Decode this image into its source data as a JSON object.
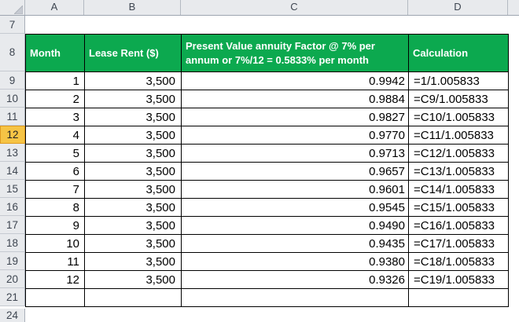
{
  "grid": {
    "columns": [
      "A",
      "B",
      "C",
      "D"
    ],
    "row_labels": [
      "7",
      "8",
      "9",
      "10",
      "11",
      "12",
      "13",
      "14",
      "15",
      "16",
      "17",
      "18",
      "19",
      "20",
      "21",
      "24"
    ],
    "selected_row_label": "12"
  },
  "table": {
    "headers": {
      "month": "Month",
      "lease_rent": "Lease Rent ($)",
      "pv_factor": "Present Value annuity Factor @ 7% per\nannum or 7%/12 = 0.5833% per month",
      "calculation": "Calculation"
    },
    "rows": [
      {
        "month": "1",
        "lease_rent": "3,500",
        "pv_factor": "0.9942",
        "calculation": "=1/1.005833"
      },
      {
        "month": "2",
        "lease_rent": "3,500",
        "pv_factor": "0.9884",
        "calculation": "=C9/1.005833"
      },
      {
        "month": "3",
        "lease_rent": "3,500",
        "pv_factor": "0.9827",
        "calculation": "=C10/1.005833"
      },
      {
        "month": "4",
        "lease_rent": "3,500",
        "pv_factor": "0.9770",
        "calculation": "=C11/1.005833"
      },
      {
        "month": "5",
        "lease_rent": "3,500",
        "pv_factor": "0.9713",
        "calculation": "=C12/1.005833"
      },
      {
        "month": "6",
        "lease_rent": "3,500",
        "pv_factor": "0.9657",
        "calculation": "=C13/1.005833"
      },
      {
        "month": "7",
        "lease_rent": "3,500",
        "pv_factor": "0.9601",
        "calculation": "=C14/1.005833"
      },
      {
        "month": "8",
        "lease_rent": "3,500",
        "pv_factor": "0.9545",
        "calculation": "=C15/1.005833"
      },
      {
        "month": "9",
        "lease_rent": "3,500",
        "pv_factor": "0.9490",
        "calculation": "=C16/1.005833"
      },
      {
        "month": "10",
        "lease_rent": "3,500",
        "pv_factor": "0.9435",
        "calculation": "=C17/1.005833"
      },
      {
        "month": "11",
        "lease_rent": "3,500",
        "pv_factor": "0.9380",
        "calculation": "=C18/1.005833"
      },
      {
        "month": "12",
        "lease_rent": "3,500",
        "pv_factor": "0.9326",
        "calculation": "=C19/1.005833"
      }
    ]
  },
  "colors": {
    "header_fill": "#0CA94F",
    "header_text": "#FFFFFF",
    "selected_row_header_fill": "#F6C445",
    "selected_row_header_border": "#DE9A20",
    "header_strip_bg": "#E8EAED",
    "table_border": "#000000"
  }
}
